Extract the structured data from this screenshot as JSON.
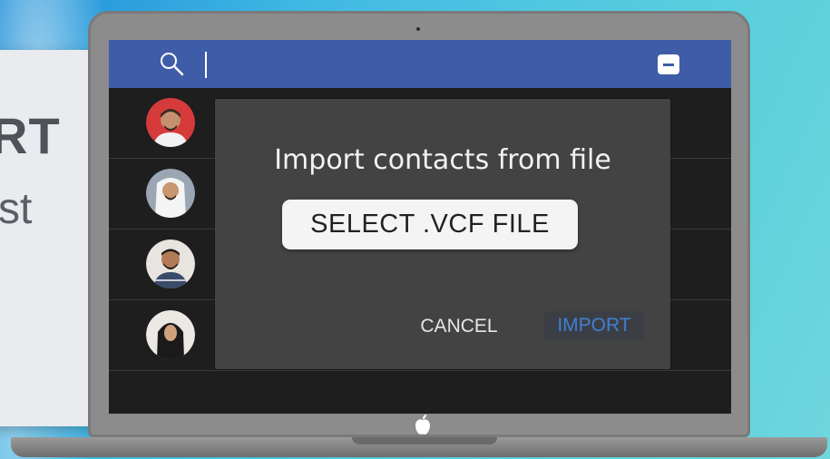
{
  "background": {
    "side_card": {
      "line1": "RT",
      "line2": "st"
    }
  },
  "app": {
    "topbar": {
      "color": "#3e5ca8",
      "search_icon": "search-icon",
      "minimize_icon": "minus-icon"
    },
    "contacts": [
      {
        "avatar": "avatar-man-red-bg"
      },
      {
        "avatar": "avatar-man-headdress"
      },
      {
        "avatar": "avatar-man-beard"
      },
      {
        "avatar": "avatar-woman-hijab"
      }
    ]
  },
  "dialog": {
    "title": "Import contacts from file",
    "select_button": "SELECT .VCF FILE",
    "cancel_button": "CANCEL",
    "import_button": "IMPORT",
    "accent_color": "#3f7fd3"
  },
  "device": {
    "logo_icon": "apple-icon"
  }
}
